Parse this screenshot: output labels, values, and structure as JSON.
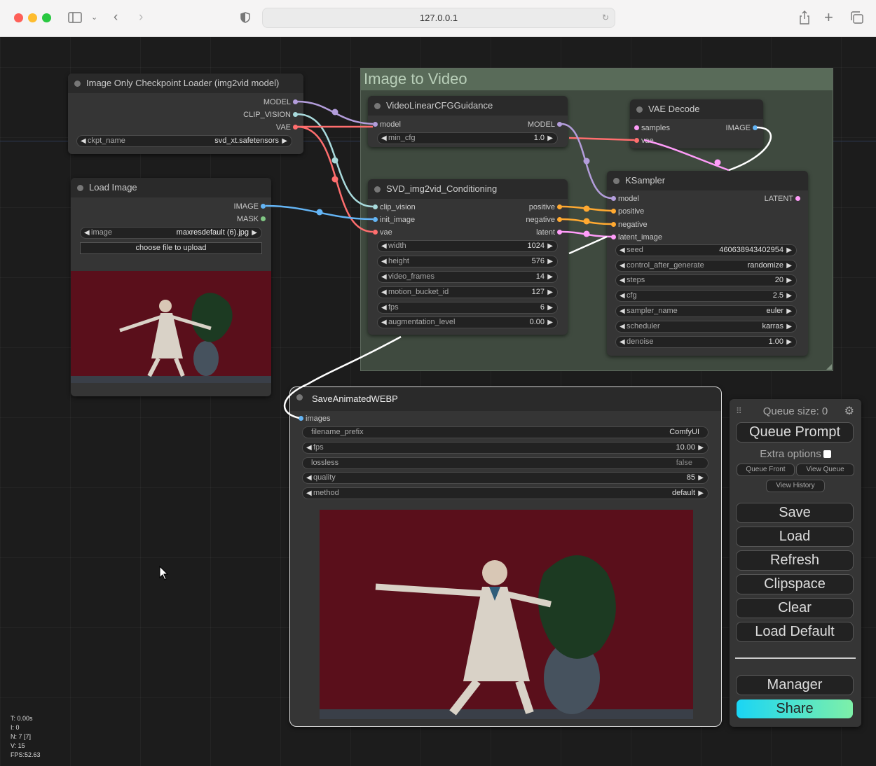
{
  "browser": {
    "url": "127.0.0.1"
  },
  "group": {
    "title": "Image to Video"
  },
  "nodes": {
    "checkpoint": {
      "title": "Image Only Checkpoint Loader (img2vid model)",
      "outputs": [
        "MODEL",
        "CLIP_VISION",
        "VAE"
      ],
      "widgets": [
        {
          "label": "ckpt_name",
          "value": "svd_xt.safetensors"
        }
      ]
    },
    "load_image": {
      "title": "Load Image",
      "outputs": [
        "IMAGE",
        "MASK"
      ],
      "widgets": [
        {
          "label": "image",
          "value": "maxresdefault (6).jpg"
        }
      ],
      "upload_label": "choose file to upload"
    },
    "cfg_guidance": {
      "title": "VideoLinearCFGGuidance",
      "inputs": [
        "model"
      ],
      "outputs": [
        "MODEL"
      ],
      "widgets": [
        {
          "label": "min_cfg",
          "value": "1.0"
        }
      ]
    },
    "svd": {
      "title": "SVD_img2vid_Conditioning",
      "inputs": [
        "clip_vision",
        "init_image",
        "vae"
      ],
      "outputs": [
        "positive",
        "negative",
        "latent"
      ],
      "widgets": [
        {
          "label": "width",
          "value": "1024"
        },
        {
          "label": "height",
          "value": "576"
        },
        {
          "label": "video_frames",
          "value": "14"
        },
        {
          "label": "motion_bucket_id",
          "value": "127"
        },
        {
          "label": "fps",
          "value": "6"
        },
        {
          "label": "augmentation_level",
          "value": "0.00"
        }
      ]
    },
    "vae_decode": {
      "title": "VAE Decode",
      "inputs": [
        "samples",
        "vae"
      ],
      "outputs": [
        "IMAGE"
      ]
    },
    "ksampler": {
      "title": "KSampler",
      "inputs": [
        "model",
        "positive",
        "negative",
        "latent_image"
      ],
      "outputs": [
        "LATENT"
      ],
      "widgets": [
        {
          "label": "seed",
          "value": "460638943402954"
        },
        {
          "label": "control_after_generate",
          "value": "randomize"
        },
        {
          "label": "steps",
          "value": "20"
        },
        {
          "label": "cfg",
          "value": "2.5"
        },
        {
          "label": "sampler_name",
          "value": "euler"
        },
        {
          "label": "scheduler",
          "value": "karras"
        },
        {
          "label": "denoise",
          "value": "1.00"
        }
      ]
    },
    "save_webp": {
      "title": "SaveAnimatedWEBP",
      "inputs": [
        "images"
      ],
      "widgets": [
        {
          "label": "filename_prefix",
          "value": "ComfyUI"
        },
        {
          "label": "fps",
          "value": "10.00"
        },
        {
          "label": "lossless",
          "value": "false"
        },
        {
          "label": "quality",
          "value": "85"
        },
        {
          "label": "method",
          "value": "default"
        }
      ]
    }
  },
  "panel": {
    "queue_size": "Queue size: 0",
    "queue_prompt": "Queue Prompt",
    "extra_options": "Extra options",
    "queue_front": "Queue Front",
    "view_queue": "View Queue",
    "view_history": "View History",
    "save": "Save",
    "load": "Load",
    "refresh": "Refresh",
    "clipspace": "Clipspace",
    "clear": "Clear",
    "load_default": "Load Default",
    "manager": "Manager",
    "share": "Share"
  },
  "stats": [
    "T: 0.00s",
    "I: 0",
    "N: 7 [7]",
    "V: 15",
    "FPS:52.63"
  ],
  "colors": {
    "model": "#b39ddb",
    "clip_vision": "#a8dadc",
    "vae": "#ff6e6e",
    "image": "#64b5f6",
    "mask": "#81c784",
    "conditioning": "#ffa931",
    "latent": "#ff9cf9"
  }
}
